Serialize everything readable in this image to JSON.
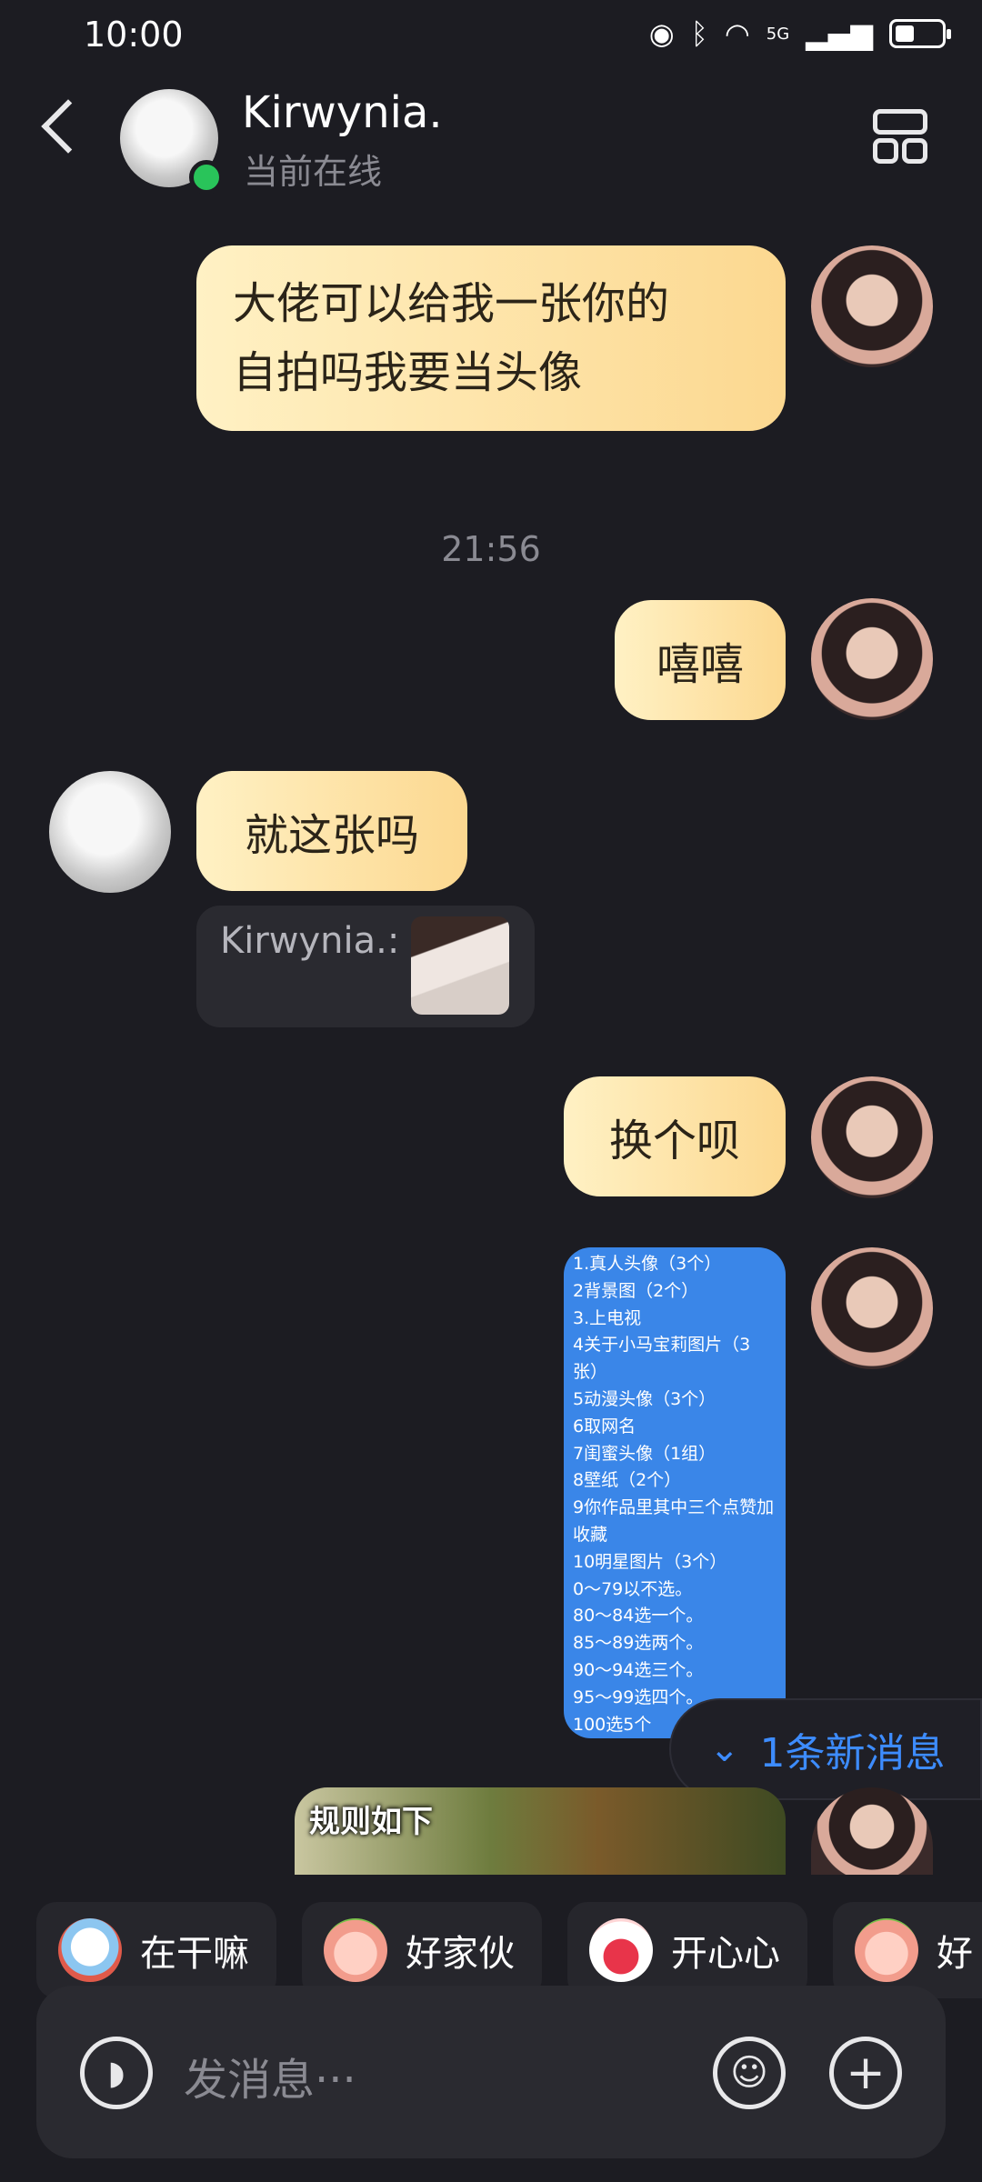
{
  "status_bar": {
    "time": "10:00",
    "network": "5G"
  },
  "header": {
    "contact_name": "Kirwynia.",
    "contact_status": "当前在线"
  },
  "messages": {
    "m1": "大佬可以给我一张你的\n自拍吗我要当头像",
    "timestamp": "21:56",
    "m2": "嘻嘻",
    "m3": "就这张吗",
    "m3_quote_name": "Kirwynia.:",
    "m4": "换个呗",
    "m5_card_lines": [
      "1.真人头像（3个）",
      "2背景图（2个）",
      "3.上电视",
      "4关于小马宝莉图片（3",
      "张）",
      "5动漫头像（3个）",
      "6取网名",
      "7闺蜜头像（1组）",
      "8壁纸（2个）",
      "9你作品里其中三个点赞加",
      "收藏",
      "10明星图片（3个）",
      "0～79以不选。",
      "80～84选一个。",
      "85～89选两个。",
      "90～94选三个。",
      "95～99选四个。",
      "100选5个"
    ],
    "m6_video_caption": "规则如下"
  },
  "new_message_pill": "1条新消息",
  "quick_replies": [
    {
      "label": "在干嘛"
    },
    {
      "label": "好家伙"
    },
    {
      "label": "开心心"
    },
    {
      "label": "好"
    }
  ],
  "input": {
    "placeholder": "发消息···"
  },
  "colors": {
    "background": "#1c1c22",
    "bubble_gradient_start": "#fff1c4",
    "bubble_gradient_end": "#fcd890",
    "accent_blue": "#3d8cff",
    "card_blue": "#3a86e8",
    "online_green": "#29c45a"
  }
}
